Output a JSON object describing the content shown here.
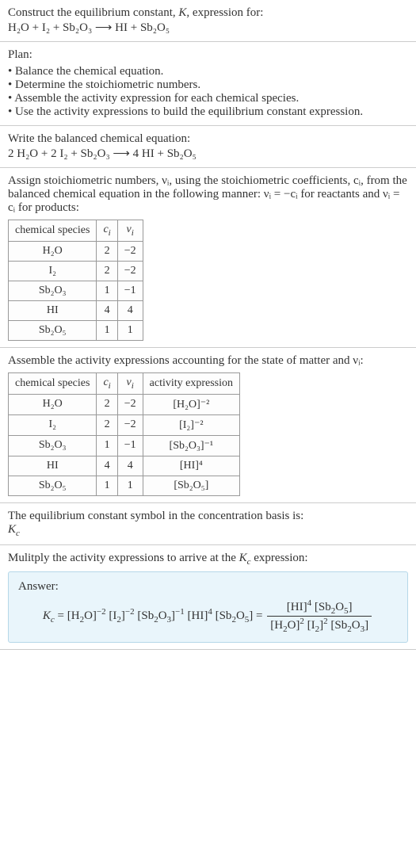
{
  "prompt": {
    "line1": "Construct the equilibrium constant, K, expression for:",
    "equation": "H₂O + I₂ + Sb₂O₃ ⟶ HI + Sb₂O₅"
  },
  "plan": {
    "heading": "Plan:",
    "items": [
      "Balance the chemical equation.",
      "Determine the stoichiometric numbers.",
      "Assemble the activity expression for each chemical species.",
      "Use the activity expressions to build the equilibrium constant expression."
    ]
  },
  "balanced": {
    "intro": "Write the balanced chemical equation:",
    "equation": "2 H₂O + 2 I₂ + Sb₂O₃ ⟶ 4 HI + Sb₂O₅"
  },
  "assign": {
    "text": "Assign stoichiometric numbers, νᵢ, using the stoichiometric coefficients, cᵢ, from the balanced chemical equation in the following manner: νᵢ = −cᵢ for reactants and νᵢ = cᵢ for products:",
    "headers": [
      "chemical species",
      "cᵢ",
      "νᵢ"
    ],
    "rows": [
      [
        "H₂O",
        "2",
        "−2"
      ],
      [
        "I₂",
        "2",
        "−2"
      ],
      [
        "Sb₂O₃",
        "1",
        "−1"
      ],
      [
        "HI",
        "4",
        "4"
      ],
      [
        "Sb₂O₅",
        "1",
        "1"
      ]
    ]
  },
  "activity": {
    "text": "Assemble the activity expressions accounting for the state of matter and νᵢ:",
    "headers": [
      "chemical species",
      "cᵢ",
      "νᵢ",
      "activity expression"
    ],
    "rows": [
      [
        "H₂O",
        "2",
        "−2",
        "[H₂O]⁻²"
      ],
      [
        "I₂",
        "2",
        "−2",
        "[I₂]⁻²"
      ],
      [
        "Sb₂O₃",
        "1",
        "−1",
        "[Sb₂O₃]⁻¹"
      ],
      [
        "HI",
        "4",
        "4",
        "[HI]⁴"
      ],
      [
        "Sb₂O₅",
        "1",
        "1",
        "[Sb₂O₅]"
      ]
    ]
  },
  "symbol": {
    "text": "The equilibrium constant symbol in the concentration basis is:",
    "value": "K_c"
  },
  "multiply": {
    "text": "Mulitply the activity expressions to arrive at the K_c expression:"
  },
  "answer": {
    "label": "Answer:",
    "lhs": "K_c = [H₂O]⁻² [I₂]⁻² [Sb₂O₃]⁻¹ [HI]⁴ [Sb₂O₅] =",
    "num": "[HI]⁴ [Sb₂O₅]",
    "den": "[H₂O]² [I₂]² [Sb₂O₃]"
  },
  "chart_data": {
    "type": "table",
    "tables": [
      {
        "title": "Stoichiometric numbers",
        "columns": [
          "chemical species",
          "c_i",
          "v_i"
        ],
        "rows": [
          [
            "H2O",
            2,
            -2
          ],
          [
            "I2",
            2,
            -2
          ],
          [
            "Sb2O3",
            1,
            -1
          ],
          [
            "HI",
            4,
            4
          ],
          [
            "Sb2O5",
            1,
            1
          ]
        ]
      },
      {
        "title": "Activity expressions",
        "columns": [
          "chemical species",
          "c_i",
          "v_i",
          "activity expression"
        ],
        "rows": [
          [
            "H2O",
            2,
            -2,
            "[H2O]^-2"
          ],
          [
            "I2",
            2,
            -2,
            "[I2]^-2"
          ],
          [
            "Sb2O3",
            1,
            -1,
            "[Sb2O3]^-1"
          ],
          [
            "HI",
            4,
            4,
            "[HI]^4"
          ],
          [
            "Sb2O5",
            1,
            1,
            "[Sb2O5]"
          ]
        ]
      }
    ]
  }
}
